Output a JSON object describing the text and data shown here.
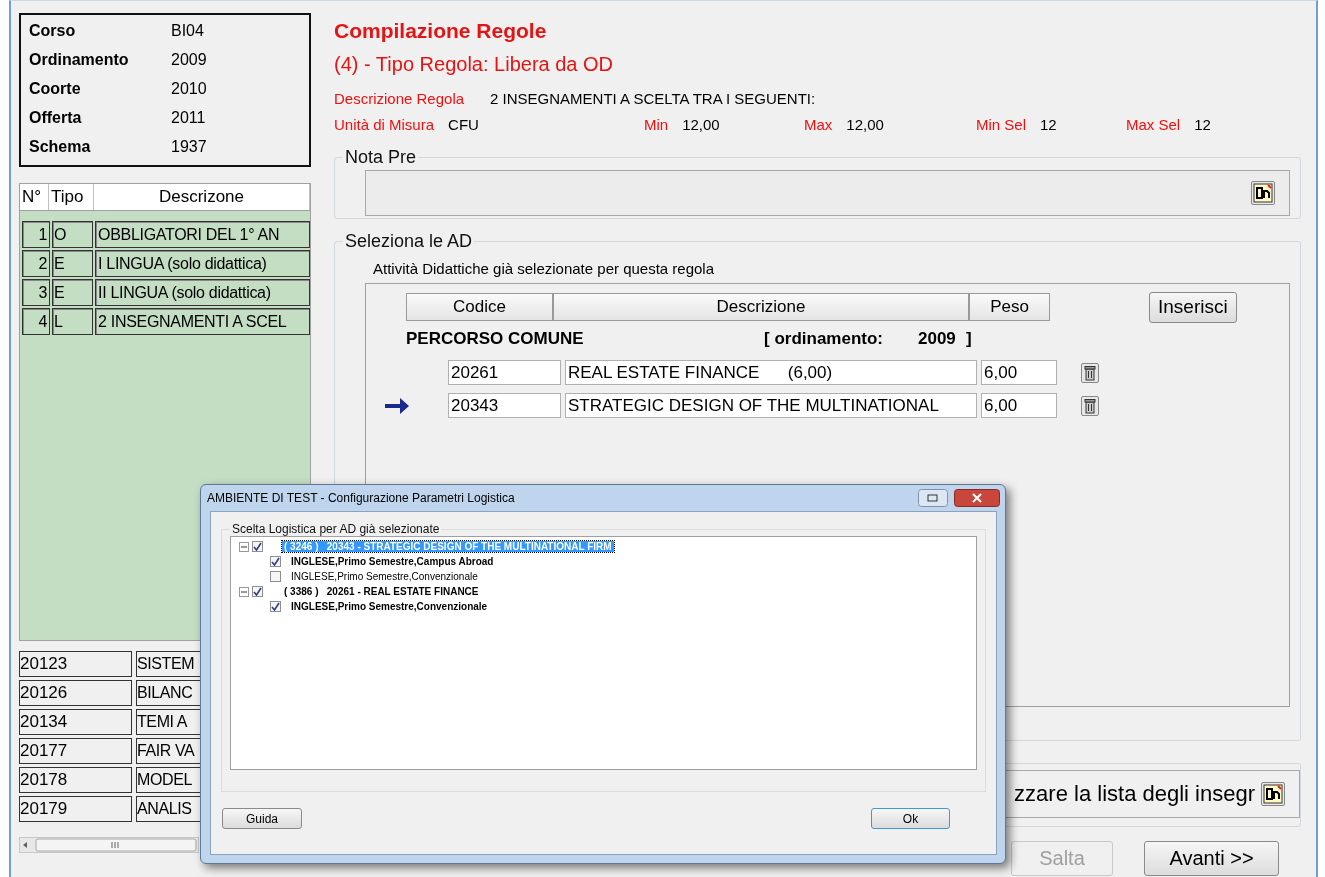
{
  "info": [
    {
      "label": "Corso",
      "value": "BI04"
    },
    {
      "label": "Ordinamento",
      "value": "2009"
    },
    {
      "label": "Coorte",
      "value": "2010"
    },
    {
      "label": "Offerta",
      "value": "2011"
    },
    {
      "label": "Schema",
      "value": "1937"
    }
  ],
  "rules_table": {
    "columns": [
      "N°",
      "Tipo",
      "Descrizone"
    ],
    "rows": [
      {
        "n": "1",
        "tipo": "O",
        "descrizione": "OBBLIGATORI DEL 1° AN"
      },
      {
        "n": "2",
        "tipo": "E",
        "descrizione": "I LINGUA (solo didattica)"
      },
      {
        "n": "3",
        "tipo": "E",
        "descrizione": "II LINGUA (solo didattica)"
      },
      {
        "n": "4",
        "tipo": "L",
        "descrizione": "2 INSEGNAMENTI A SCEL"
      }
    ]
  },
  "codes_list": [
    {
      "code": "20123",
      "desc": "SISTEM"
    },
    {
      "code": "20126",
      "desc": "BILANC"
    },
    {
      "code": "20134",
      "desc": "TEMI A"
    },
    {
      "code": "20177",
      "desc": "FAIR VA"
    },
    {
      "code": "20178",
      "desc": "MODEL"
    },
    {
      "code": "20179",
      "desc": "ANALIS"
    }
  ],
  "title": "Compilazione Regole",
  "subtitle": "(4) - Tipo Regola: Libera da OD",
  "descrizione": {
    "label": "Descrizione Regola",
    "value": "2 INSEGNAMENTI A SCELTA TRA I SEGUENTI:"
  },
  "measures": [
    {
      "label": "Unità di Misura",
      "value": "CFU"
    },
    {
      "label": "Min",
      "value": "12,00"
    },
    {
      "label": "Max",
      "value": "12,00"
    },
    {
      "label": "Min Sel",
      "value": "12"
    },
    {
      "label": "Max Sel",
      "value": "12"
    }
  ],
  "nota_pre": {
    "legend": "Nota Pre"
  },
  "selection": {
    "legend": "Seleziona le AD",
    "caption": "Attività Didattiche già selezionate per questa regola",
    "columns": [
      "Codice",
      "Descrizione",
      "Peso"
    ],
    "insert_button": "Inserisci",
    "section": {
      "name": "PERCORSO COMUNE",
      "ord_label": "[ ordinamento:",
      "ord_value": "2009",
      "ord_close": "]"
    },
    "rows": [
      {
        "codice": "20261",
        "descrizione": "REAL ESTATE FINANCE      (6,00)",
        "peso": "6,00",
        "current": false
      },
      {
        "codice": "20343",
        "descrizione": "STRATEGIC DESIGN OF THE MULTINATIONAL",
        "peso": "6,00",
        "current": true
      }
    ]
  },
  "list_note": "zzare la lista degli insegr",
  "buttons": [
    {
      "label": "Salta",
      "disabled": true
    },
    {
      "label": "Avanti >>",
      "disabled": false
    }
  ],
  "dialog": {
    "title": "AMBIENTE DI TEST - Configurazione Parametri Logistica",
    "legend": "Scelta Logistica per AD già selezionate",
    "tree": [
      {
        "label": "( 3246 )   20343 - STRATEGIC DESIGN OF THE MULTINATIONAL FIRM",
        "checked": true,
        "expanded": true,
        "selected": true,
        "children": [
          {
            "label": "INGLESE,Primo Semestre,Campus Abroad",
            "checked": true
          },
          {
            "label": "INGLESE,Primo Semestre,Convenzionale",
            "checked": false
          }
        ]
      },
      {
        "label": "( 3386 )   20261 - REAL ESTATE FINANCE",
        "checked": true,
        "expanded": true,
        "selected": false,
        "children": [
          {
            "label": "INGLESE,Primo Semestre,Convenzionale",
            "checked": true
          }
        ]
      }
    ],
    "buttons": [
      "Guida",
      "Ok"
    ]
  }
}
